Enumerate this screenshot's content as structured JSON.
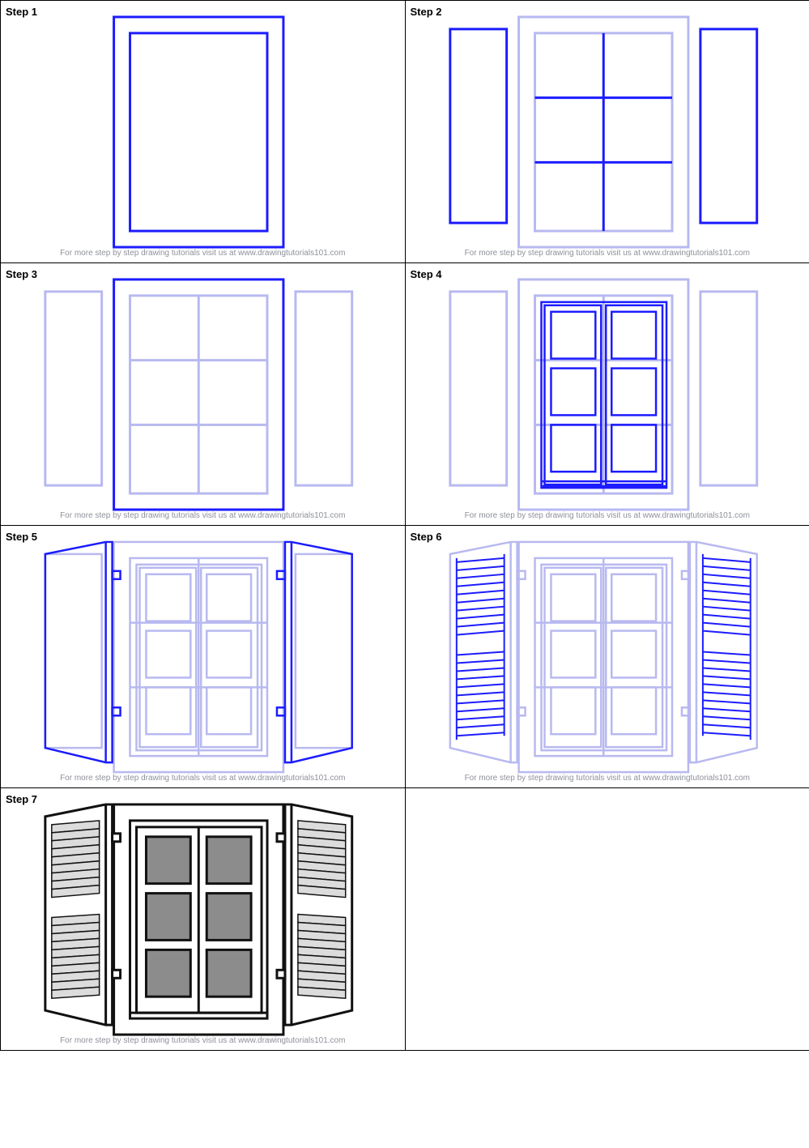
{
  "steps": [
    {
      "label": "Step 1"
    },
    {
      "label": "Step 2"
    },
    {
      "label": "Step 3"
    },
    {
      "label": "Step 4"
    },
    {
      "label": "Step 5"
    },
    {
      "label": "Step 6"
    },
    {
      "label": "Step 7"
    }
  ],
  "footer_text": "For more step by step drawing tutorials visit us at www.drawingtutorials101.com",
  "colors": {
    "fresh": "#1c1cff",
    "faded": "#b8b9f0",
    "final_stroke": "#111",
    "final_fill_dark": "#8c8c8c",
    "final_fill_light": "#dcdcdc"
  }
}
